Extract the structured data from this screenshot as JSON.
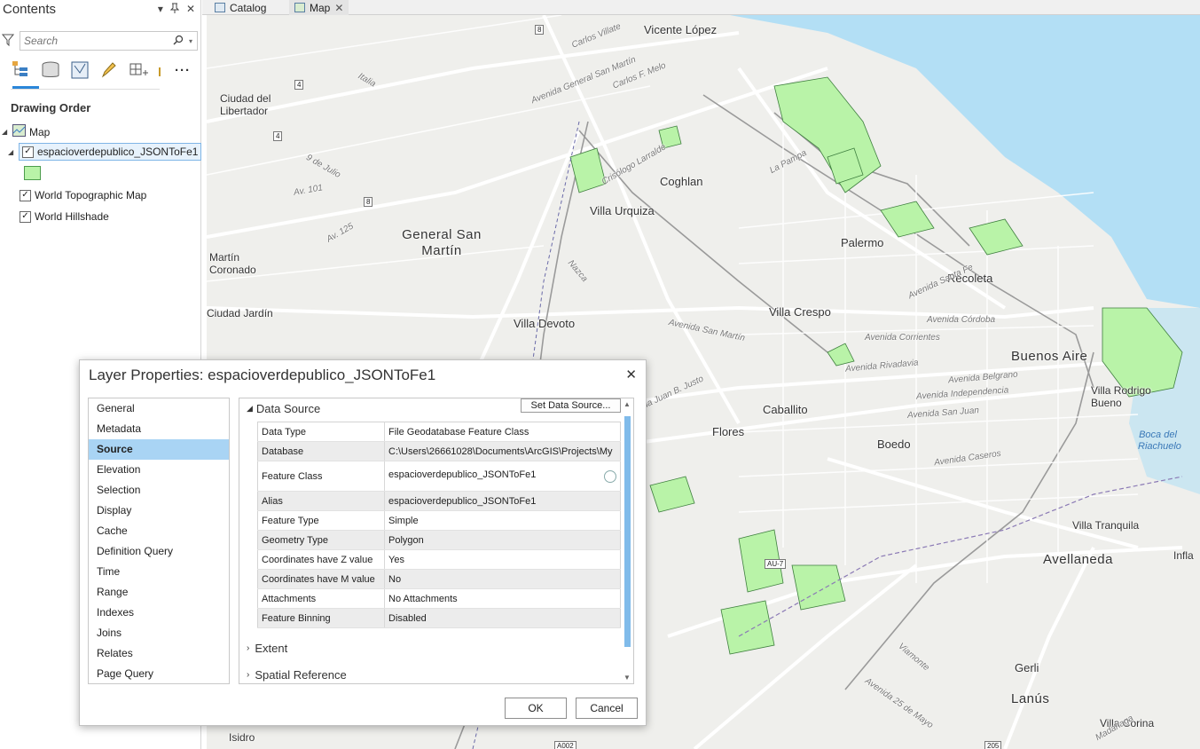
{
  "contents": {
    "title": "Contents",
    "search_placeholder": "Search",
    "drawing_order_label": "Drawing Order",
    "layers": [
      {
        "name": "Map",
        "checked": null
      },
      {
        "name": "espacioverdepublico_JSONToFe1",
        "checked": true
      },
      {
        "name": "World Topographic Map",
        "checked": true
      },
      {
        "name": "World Hillshade",
        "checked": true
      }
    ]
  },
  "tabs": [
    {
      "label": "Catalog"
    },
    {
      "label": "Map"
    }
  ],
  "map": {
    "places": [
      "Vicente López",
      "Ciudad del Libertador",
      "Coghlan",
      "Villa Urquiza",
      "General San Martín",
      "Palermo",
      "Recoleta",
      "Martín Coronado",
      "Ciudad Jardín",
      "Villa Crespo",
      "Villa Devoto",
      "Buenos Aire",
      "Villa Rodrigo Bueno",
      "Caballito",
      "Flores",
      "Boedo",
      "Villa Tranquila",
      "Avellaneda",
      "Infla",
      "Gerli",
      "Lanús",
      "Villa Corina",
      "Isidro"
    ],
    "roads": [
      "Avenida General San Martín",
      "Carlos Villate",
      "Carlos F. Melo",
      "Italia",
      "9 de Julio",
      "Av. 101",
      "Av. 125",
      "Nazca",
      "Avenida San Martín",
      "Avenida Córdoba",
      "Avenida Corrientes",
      "Avenida Rivadavia",
      "Avenida Belgrano",
      "Avenida Independencia",
      "Avenida San Juan",
      "Avenida Juan B. Justo",
      "Avenida Caseros",
      "Viamonte",
      "Avenida 25 de Mayo",
      "Madariaga",
      "La Pampa",
      "Crisólogo Larralde",
      "Avenida Santa Fe"
    ],
    "water": [
      "Boca del Riachuelo"
    ],
    "shields": [
      "8",
      "4",
      "4",
      "8",
      "AU-7",
      "A002",
      "205"
    ]
  },
  "dialog": {
    "title": "Layer Properties: espacioverdepublico_JSONToFe1",
    "nav_items": [
      "General",
      "Metadata",
      "Source",
      "Elevation",
      "Selection",
      "Display",
      "Cache",
      "Definition Query",
      "Time",
      "Range",
      "Indexes",
      "Joins",
      "Relates",
      "Page Query"
    ],
    "active_nav": "Source",
    "data_source_label": "Data Source",
    "set_data_source_label": "Set Data Source...",
    "properties": [
      {
        "key": "Data Type",
        "value": "File Geodatabase Feature Class"
      },
      {
        "key": "Database",
        "value": "C:\\Users\\26661028\\Documents\\ArcGIS\\Projects\\My"
      },
      {
        "key": "Feature Class",
        "value": "espacioverdepublico_JSONToFe1"
      },
      {
        "key": "Alias",
        "value": "espacioverdepublico_JSONToFe1"
      },
      {
        "key": "Feature Type",
        "value": "Simple"
      },
      {
        "key": "Geometry Type",
        "value": "Polygon"
      },
      {
        "key": "Coordinates have Z value",
        "value": "Yes"
      },
      {
        "key": "Coordinates have M value",
        "value": "No"
      },
      {
        "key": "Attachments",
        "value": "No Attachments"
      },
      {
        "key": "Feature Binning",
        "value": "Disabled"
      }
    ],
    "extent_label": "Extent",
    "spatial_reference_label": "Spatial Reference",
    "ok_label": "OK",
    "cancel_label": "Cancel"
  },
  "colors": {
    "water": "#b3dff5",
    "land": "#efefec",
    "park": "#b9f3a8",
    "accent": "#2b86d9",
    "nav_selected": "#a9d4f4"
  }
}
